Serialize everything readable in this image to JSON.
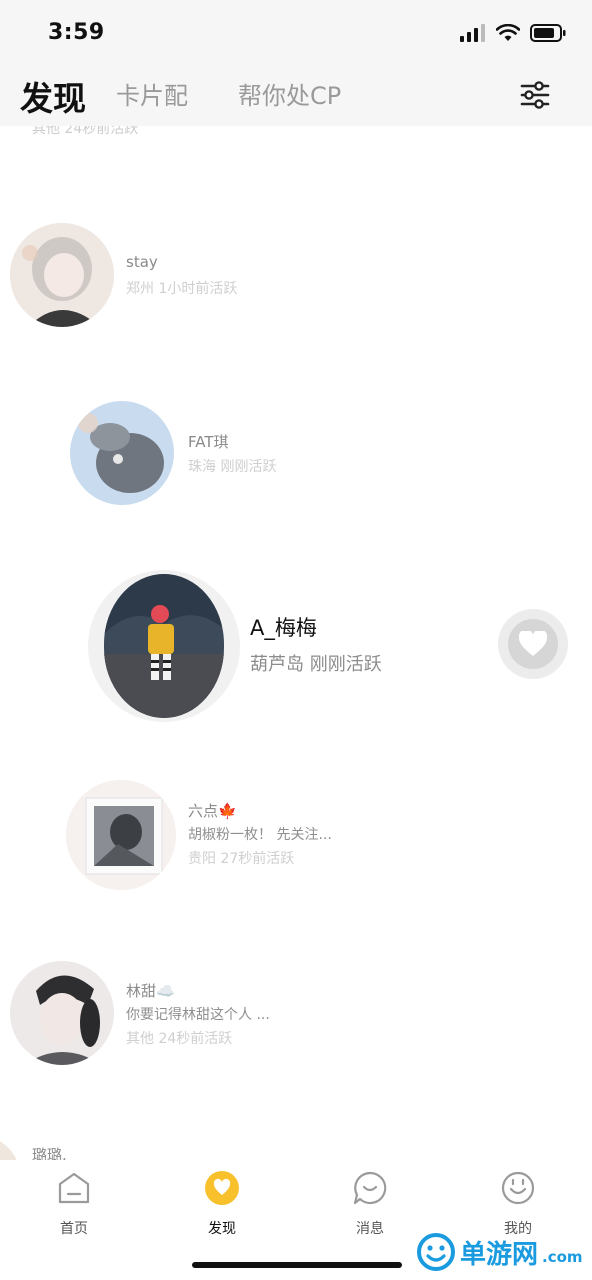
{
  "status_bar": {
    "time": "3:59"
  },
  "top_nav": {
    "tabs": [
      {
        "label": "发现"
      },
      {
        "label": "卡片配"
      },
      {
        "label": "帮你处CP"
      }
    ]
  },
  "feed": {
    "ghost_text": "其他 24秒前活跃",
    "users": [
      {
        "name": "stay",
        "info": "郑州 1小时前活跃"
      },
      {
        "name": "FAT琪",
        "info": "珠海 刚刚活跃"
      },
      {
        "name": "A_梅梅",
        "info": "葫芦岛 刚刚活跃"
      },
      {
        "name": "六点🍁",
        "bio": "胡椒粉一枚！ 先关注...",
        "info": "贵阳 27秒前活跃"
      },
      {
        "name": "林甜☁️",
        "bio": "你要记得林甜这个人 ...",
        "info": "其他 24秒前活跃"
      },
      {
        "name": "璐璐."
      }
    ]
  },
  "bottom_nav": {
    "items": [
      {
        "label": "首页"
      },
      {
        "label": "发现"
      },
      {
        "label": "消息"
      },
      {
        "label": "我的"
      }
    ]
  },
  "watermark": {
    "brand": "单游网",
    "suffix": ".com"
  },
  "colors": {
    "accent": "#f8c12c",
    "watermark": "#1a9be0"
  }
}
